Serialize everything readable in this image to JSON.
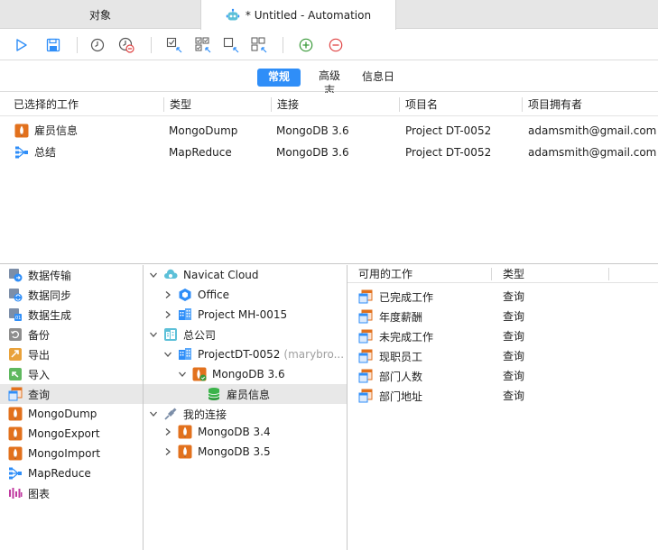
{
  "tabs": {
    "objects": "对象",
    "automation": "* Untitled - Automation"
  },
  "toolbar": {
    "buttons": [
      "play-icon",
      "save-icon",
      "schedule-icon",
      "delete-schedule-icon",
      "select-all-icon",
      "select-all-move-icon",
      "deselect-icon",
      "deselect-all-icon",
      "add-icon",
      "remove-icon"
    ]
  },
  "segments": {
    "general": "常规",
    "advanced": "高级\n志",
    "log": "信息日"
  },
  "jobs": {
    "columns": [
      "已选择的工作",
      "类型",
      "连接",
      "项目名",
      "项目拥有者"
    ],
    "rows": [
      {
        "name": "雇员信息",
        "type": "MongoDump",
        "connection": "MongoDB 3.6",
        "project": "Project DT-0052",
        "owner": "adamsmith@gmail.com"
      },
      {
        "name": "总结",
        "type": "MapReduce",
        "connection": "MongoDB 3.6",
        "project": "Project DT-0052",
        "owner": "adamsmith@gmail.com"
      }
    ]
  },
  "categories": [
    "数据传输",
    "数据同步",
    "数据生成",
    "备份",
    "导出",
    "导入",
    "查询",
    "MongoDump",
    "MongoExport",
    "MongoImport",
    "MapReduce",
    "图表"
  ],
  "tree": {
    "navicat_cloud": "Navicat Cloud",
    "office": "Office",
    "project_mh": "Project MH-0015",
    "company": "总公司",
    "project_dt": "ProjectDT-0052",
    "project_dt_owner": "(marybro...",
    "mongodb36": "MongoDB 3.6",
    "employee_info": "雇员信息",
    "my_connections": "我的连接",
    "mongodb34": "MongoDB 3.4",
    "mongodb35": "MongoDB 3.5"
  },
  "available": {
    "columns": [
      "可用的工作",
      "类型"
    ],
    "rows": [
      {
        "name": "已完成工作",
        "type": "查询"
      },
      {
        "name": "年度薪酬",
        "type": "查询"
      },
      {
        "name": "未完成工作",
        "type": "查询"
      },
      {
        "name": "现职员工",
        "type": "查询"
      },
      {
        "name": "部门人数",
        "type": "查询"
      },
      {
        "name": "部门地址",
        "type": "查询"
      }
    ]
  },
  "colors": {
    "accent": "#2f8ef8",
    "mongo": "#e2711d",
    "green": "#3a9a3a",
    "red": "#e04444"
  }
}
